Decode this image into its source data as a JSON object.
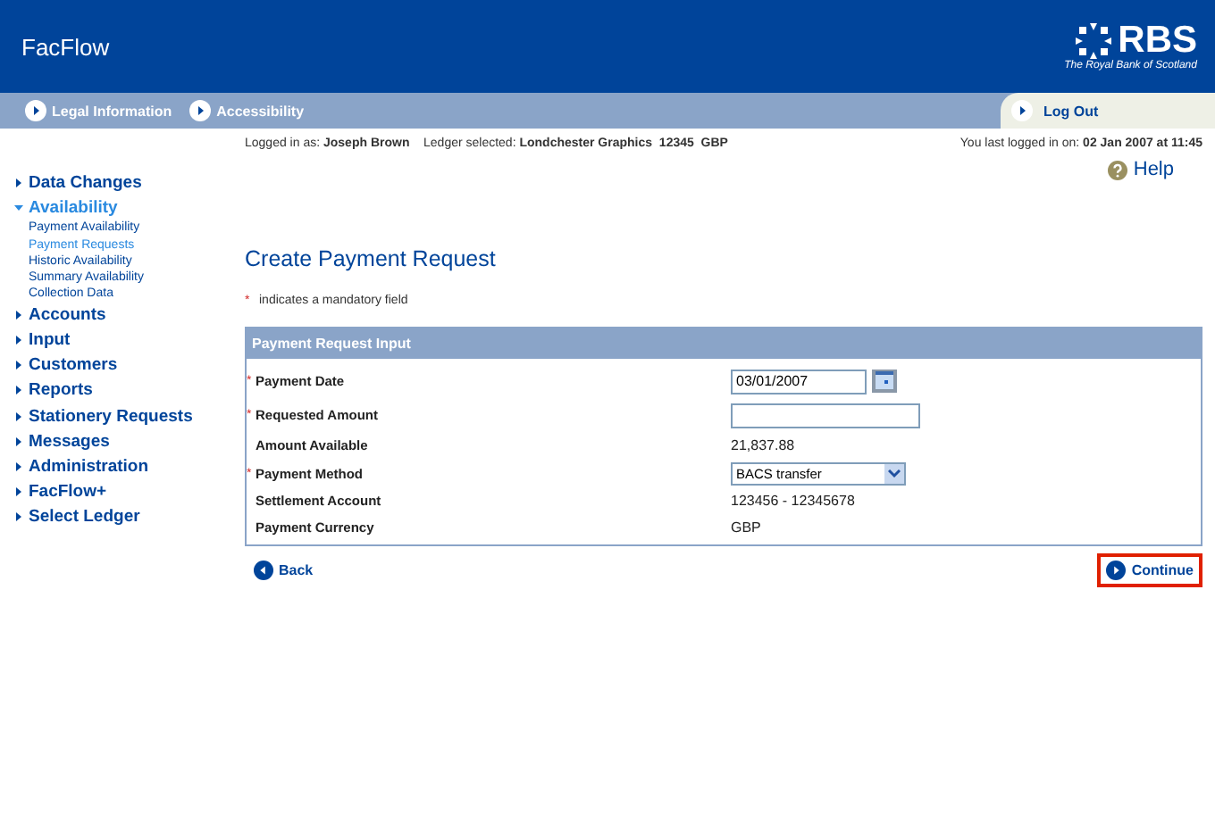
{
  "header": {
    "app_title": "FacFlow",
    "logo_text": "RBS",
    "logo_tagline": "The Royal Bank of Scotland"
  },
  "top_nav": {
    "links": [
      "Legal Information",
      "Accessibility"
    ],
    "logout": "Log Out"
  },
  "session": {
    "logged_in_label": "Logged in as:",
    "user": "Joseph Brown",
    "ledger_label": "Ledger selected:",
    "ledger": "Londchester Graphics  12345  GBP",
    "last_login_label": "You last logged in on:",
    "last_login": "02 Jan 2007 at 11:45"
  },
  "help": "Help",
  "sidebar": {
    "items": [
      {
        "label": "Data Changes",
        "selected": false,
        "expanded": false
      },
      {
        "label": "Availability",
        "selected": true,
        "expanded": true,
        "children": [
          {
            "label": "Payment Availability",
            "selected": false
          },
          {
            "label": "Payment Requests",
            "selected": true
          },
          {
            "label": "Historic Availability",
            "selected": false
          },
          {
            "label": "Summary Availability",
            "selected": false
          },
          {
            "label": "Collection Data",
            "selected": false
          }
        ]
      },
      {
        "label": "Accounts",
        "selected": false,
        "expanded": false
      },
      {
        "label": "Input",
        "selected": false,
        "expanded": false
      },
      {
        "label": "Customers",
        "selected": false,
        "expanded": false
      },
      {
        "label": "Reports",
        "selected": false,
        "expanded": false
      },
      {
        "label": "Stationery Requests",
        "selected": false,
        "expanded": false
      },
      {
        "label": "Messages",
        "selected": false,
        "expanded": false
      },
      {
        "label": "Administration",
        "selected": false,
        "expanded": false
      },
      {
        "label": "FacFlow+",
        "selected": false,
        "expanded": false
      },
      {
        "label": "Select Ledger",
        "selected": false,
        "expanded": false
      }
    ]
  },
  "page_title": "Create Payment Request",
  "mandatory_note": {
    "marker": "*",
    "text": "indicates a mandatory field"
  },
  "panel": {
    "title": "Payment Request Input",
    "rows": [
      {
        "kind": "date",
        "required": true,
        "label": "Payment Date",
        "value": "03/01/2007"
      },
      {
        "kind": "input",
        "required": true,
        "label": "Requested Amount"
      },
      {
        "kind": "text",
        "required": false,
        "label": "Amount Available",
        "value": "21,837.88"
      },
      {
        "kind": "select",
        "required": true,
        "label": "Payment Method",
        "value": "BACS transfer"
      },
      {
        "kind": "text",
        "required": false,
        "label": "Settlement Account",
        "value": "123456 - 12345678"
      },
      {
        "kind": "text",
        "required": false,
        "label": "Payment Currency",
        "value": "GBP"
      }
    ]
  },
  "actions": {
    "back": "Back",
    "continue": {
      "label": "Continue",
      "highlighted": true
    }
  }
}
